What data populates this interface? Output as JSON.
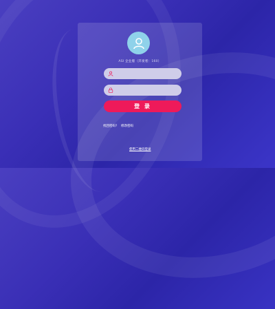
{
  "colors": {
    "accent": "#ee1a5a",
    "avatar": "#8fd2ea",
    "field": "#cfcde9"
  },
  "header": {
    "subtitle": "ASI 企业版（开发者：160）"
  },
  "form": {
    "username_placeholder": "",
    "password_placeholder": "",
    "login_label": "登 录"
  },
  "links": {
    "forgot": "找回密码?",
    "reset": "修改密码",
    "qr": "使用二维码登录"
  },
  "icons": {
    "avatar": "user-icon",
    "username": "user-icon",
    "password": "lock-icon"
  }
}
